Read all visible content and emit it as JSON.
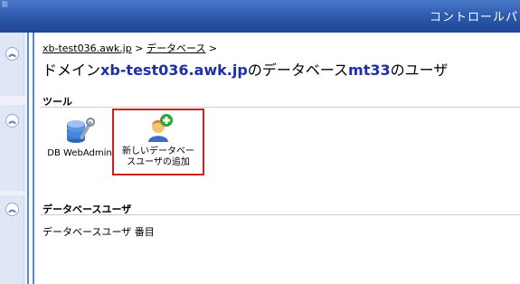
{
  "header": {
    "tiny_text": "肪",
    "title": "コントロールパ"
  },
  "breadcrumb": {
    "host_link": "xb-test036.awk.jp",
    "separator1": " > ",
    "db_link": "データベース",
    "separator2": " >"
  },
  "page_title": {
    "prefix": "ドメイン",
    "domain": "xb-test036.awk.jp",
    "middle": "のデータベース",
    "db_name": "mt33",
    "suffix": "のユーザ"
  },
  "tools_section": {
    "title": "ツール",
    "items": [
      {
        "label": "DB WebAdmin",
        "icon": "database-settings-icon"
      },
      {
        "label_line1": "新しいデータベー",
        "label_line2": "スユーザの追加",
        "icon": "add-user-icon",
        "selected": true
      }
    ]
  },
  "users_section": {
    "title": "データベースユーザ",
    "empty_text": "データベースユーザ 番目"
  },
  "colors": {
    "header_blue": "#2b57aa",
    "link_blue": "#1d2fa8",
    "selection_red": "#d0201c"
  }
}
